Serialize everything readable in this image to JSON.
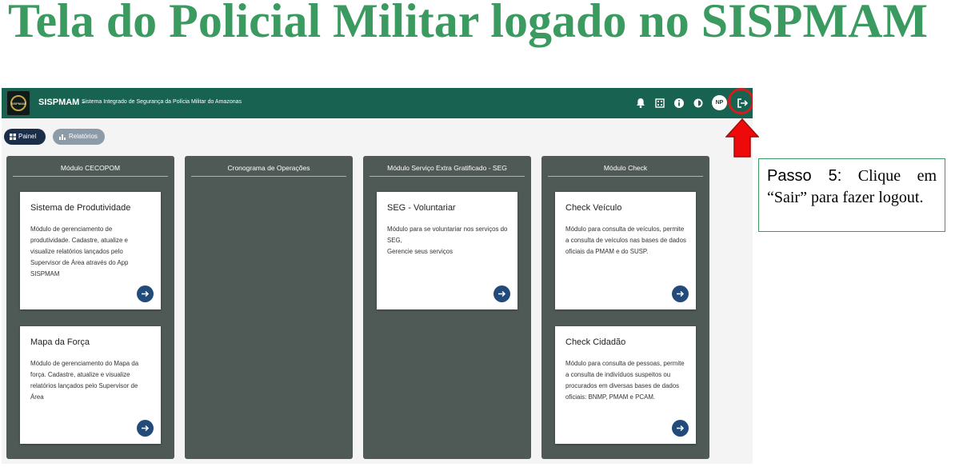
{
  "doc_title": "Tela do Policial Militar logado no SISPMAM",
  "header": {
    "logo_text": "SISPMAM",
    "app_name": "SISPMAM -",
    "app_subtitle": "Sistema Integrado de Segurança da Polícia Militar do Amazonas",
    "avatar_initials": "NP"
  },
  "tabs": [
    {
      "label": "Painel"
    },
    {
      "label": "Relatórios"
    }
  ],
  "modules": [
    {
      "title": "Módulo CECOPOM",
      "cards": [
        {
          "title": "Sistema de Produtividade",
          "desc": "Módulo de gerenciamento de produtividade. Cadastre, atualize e visualize relatórios lançados pelo Supervisor de Área através do App SISPMAM"
        },
        {
          "title": "Mapa da Força",
          "desc": "Módulo de gerenciamento do Mapa da força. Cadastre, atualize e visualize relatórios lançados pelo Supervisor de Área"
        }
      ]
    },
    {
      "title": "Cronograma de Operações",
      "cards": []
    },
    {
      "title": "Módulo Serviço Extra Gratificado - SEG",
      "cards": [
        {
          "title": "SEG - Voluntariar",
          "desc": "Módulo para se voluntariar nos serviços do SEG,\nGerencie seus serviços"
        }
      ]
    },
    {
      "title": "Módulo Check",
      "cards": [
        {
          "title": "Check Veículo",
          "desc": "Módulo para consulta de veículos, permite a consulta de veículos nas bases de dados oficiais da PMAM e do SUSP."
        },
        {
          "title": "Check Cidadão",
          "desc": "Módulo para consulta de pessoas, permite a consulta de indivíduos suspeitos ou procurados em diversas bases de dados oficiais: BNMP, PMAM e PCAM."
        }
      ]
    }
  ],
  "note": {
    "step": "Passo 5:",
    "text": " Clique em “Sair” para fazer logout."
  },
  "colors": {
    "topbar": "#176251",
    "column": "#4f5a57",
    "accent_title": "#3a9a5f",
    "highlight": "#d41e1e"
  }
}
